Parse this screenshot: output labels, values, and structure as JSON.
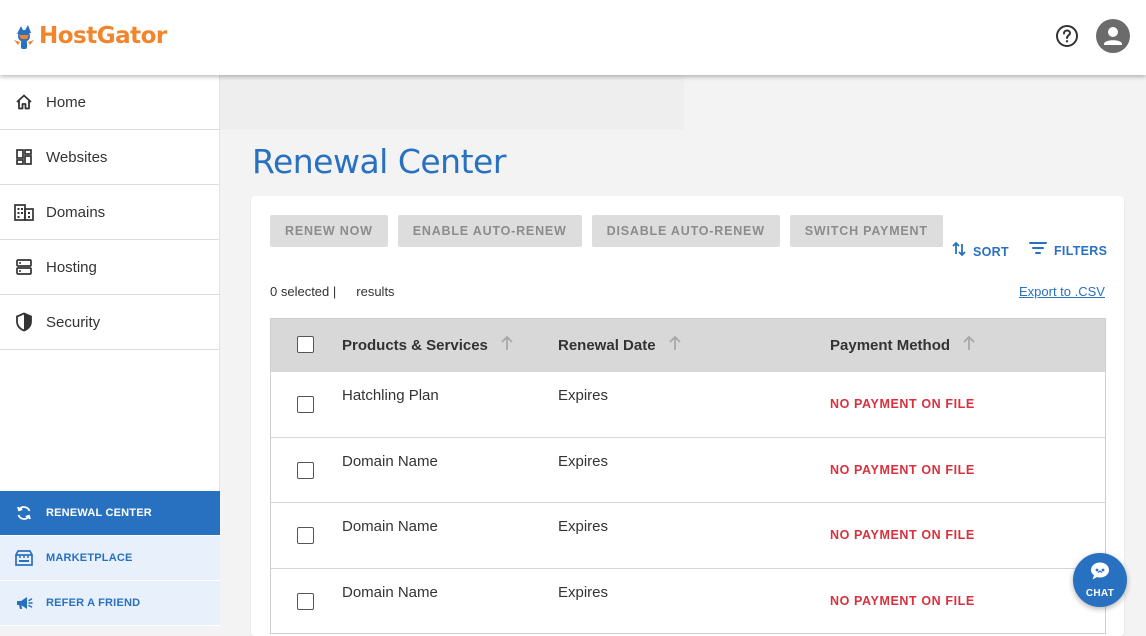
{
  "brand": {
    "name": "HostGator",
    "color": "#f2852b",
    "accent": "#2870c0"
  },
  "header": {
    "help_icon": "help-circle-icon",
    "avatar_icon": "user-avatar-icon"
  },
  "sidebar": {
    "items": [
      {
        "label": "Home",
        "icon": "home-icon"
      },
      {
        "label": "Websites",
        "icon": "dashboard-icon"
      },
      {
        "label": "Domains",
        "icon": "building-icon"
      },
      {
        "label": "Hosting",
        "icon": "server-icon"
      },
      {
        "label": "Security",
        "icon": "shield-icon"
      }
    ],
    "sub_items": [
      {
        "label": "RENEWAL CENTER",
        "icon": "refresh-icon",
        "active": true
      },
      {
        "label": "MARKETPLACE",
        "icon": "storefront-icon",
        "active": false
      },
      {
        "label": "REFER A FRIEND",
        "icon": "megaphone-icon",
        "active": false
      }
    ]
  },
  "page": {
    "title": "Renewal Center"
  },
  "toolbar": {
    "renew_now": "RENEW NOW",
    "enable_auto_renew": "ENABLE AUTO-RENEW",
    "disable_auto_renew": "DISABLE AUTO-RENEW",
    "switch_payment": "SWITCH PAYMENT",
    "sort": "SORT",
    "filters": "FILTERS"
  },
  "summary": {
    "selected": "0 selected |",
    "results": "results",
    "export": "Export to .CSV"
  },
  "table": {
    "columns": [
      "Products & Services",
      "Renewal Date",
      "Payment Method"
    ],
    "rows": [
      {
        "product": "Hatchling Plan",
        "renewal": "Expires",
        "payment": "NO PAYMENT ON FILE"
      },
      {
        "product": "Domain Name",
        "renewal": "Expires",
        "payment": "NO PAYMENT ON FILE"
      },
      {
        "product": "Domain Name",
        "renewal": "Expires",
        "payment": "NO PAYMENT ON FILE"
      },
      {
        "product": "Domain Name",
        "renewal": "Expires",
        "payment": "NO PAYMENT ON FILE"
      }
    ]
  },
  "chat": {
    "label": "CHAT",
    "icon": "chat-bubble-icon"
  },
  "colors": {
    "error": "#d8303d",
    "disabled_button": "#dddddd"
  }
}
